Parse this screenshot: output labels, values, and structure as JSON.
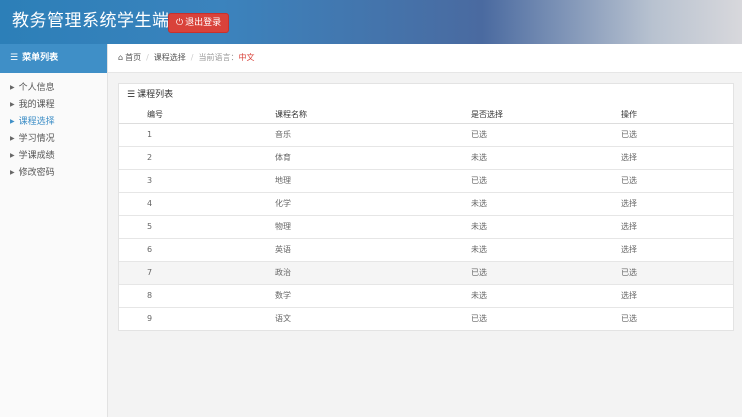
{
  "header": {
    "title": "教务管理系统学生端",
    "logout_label": "退出登录"
  },
  "sidebar": {
    "title": "菜单列表",
    "items": [
      {
        "label": "个人信息"
      },
      {
        "label": "我的课程"
      },
      {
        "label": "课程选择"
      },
      {
        "label": "学习情况"
      },
      {
        "label": "学课成绩"
      },
      {
        "label": "修改密码"
      }
    ],
    "active_index": 2
  },
  "breadcrumb": {
    "home": "首页",
    "current": "课程选择",
    "lang_prefix": "当前语言：",
    "lang_value": "中文"
  },
  "panel": {
    "title": "课程列表",
    "columns": [
      "编号",
      "课程名称",
      "是否选择",
      "操作"
    ],
    "rows": [
      {
        "id": "1",
        "name": "音乐",
        "status": "已选",
        "action": "已选"
      },
      {
        "id": "2",
        "name": "体育",
        "status": "未选",
        "action": "选择"
      },
      {
        "id": "3",
        "name": "地理",
        "status": "已选",
        "action": "已选"
      },
      {
        "id": "4",
        "name": "化学",
        "status": "未选",
        "action": "选择"
      },
      {
        "id": "5",
        "name": "物理",
        "status": "未选",
        "action": "选择"
      },
      {
        "id": "6",
        "name": "英语",
        "status": "未选",
        "action": "选择"
      },
      {
        "id": "7",
        "name": "政治",
        "status": "已选",
        "action": "已选"
      },
      {
        "id": "8",
        "name": "数学",
        "status": "未选",
        "action": "选择"
      },
      {
        "id": "9",
        "name": "语文",
        "status": "已选",
        "action": "已选"
      }
    ]
  },
  "colors": {
    "accent": "#3f8fc7",
    "danger": "#d9423a",
    "success": "#3aa83a"
  },
  "icons": {
    "logout": "power-icon",
    "menu": "menu-icon",
    "home": "home-icon",
    "list": "list-icon",
    "caret": "caret-right-icon"
  }
}
